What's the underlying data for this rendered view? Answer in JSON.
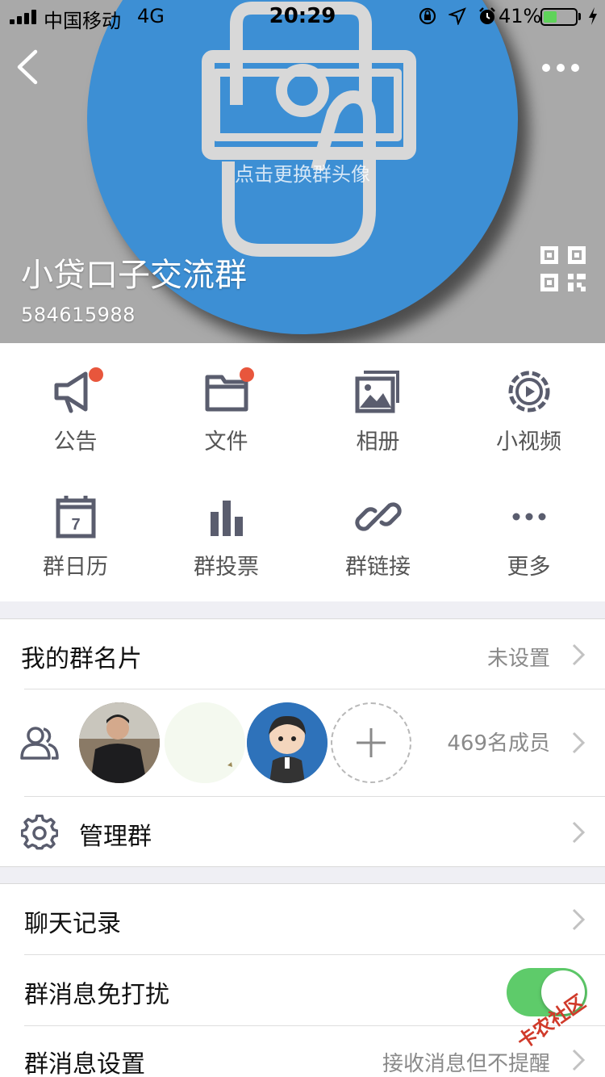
{
  "status_bar": {
    "carrier": "中国移动",
    "network": "4G",
    "time": "20:29",
    "battery_percent": "41%",
    "battery_level": 0.41,
    "icons": [
      "rotation-lock-icon",
      "location-icon",
      "alarm-icon",
      "charging-icon"
    ]
  },
  "header": {
    "change_avatar_hint": "点击更换群头像",
    "group_name": "小贷口子交流群",
    "group_id": "584615988",
    "background_color": "#a9a9a9",
    "avatar_color": "#3d8fd4"
  },
  "functions": [
    {
      "label": "公告",
      "icon": "megaphone-icon",
      "has_dot": true
    },
    {
      "label": "文件",
      "icon": "folder-icon",
      "has_dot": true
    },
    {
      "label": "相册",
      "icon": "photo-album-icon",
      "has_dot": false
    },
    {
      "label": "小视频",
      "icon": "video-play-icon",
      "has_dot": false
    },
    {
      "label": "群日历",
      "icon": "calendar-icon",
      "has_dot": false,
      "calendar_day": "7"
    },
    {
      "label": "群投票",
      "icon": "bar-chart-icon",
      "has_dot": false
    },
    {
      "label": "群链接",
      "icon": "link-icon",
      "has_dot": false
    },
    {
      "label": "更多",
      "icon": "more-dots-icon",
      "has_dot": false
    }
  ],
  "card_row": {
    "title": "我的群名片",
    "value": "未设置"
  },
  "members_row": {
    "count_text": "469名成员"
  },
  "manage_row": {
    "title": "管理群"
  },
  "chat_history_row": {
    "title": "聊天记录"
  },
  "dnd_row": {
    "title": "群消息免打扰",
    "enabled": true
  },
  "message_settings_row": {
    "title": "群消息设置",
    "value": "接收消息但不提醒"
  },
  "watermark": {
    "text": "卡农社区"
  },
  "colors": {
    "accent_red": "#e8563c",
    "toggle_green": "#5ecb6a",
    "icon_gray": "#5a5d6e"
  }
}
